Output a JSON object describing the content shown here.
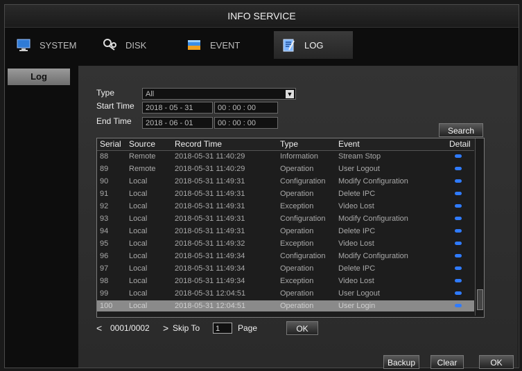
{
  "window": {
    "title": "INFO SERVICE"
  },
  "tabs": [
    {
      "label": "SYSTEM",
      "icon": "monitor-icon",
      "active": false
    },
    {
      "label": "DISK",
      "icon": "disk-icon",
      "active": false
    },
    {
      "label": "EVENT",
      "icon": "event-icon",
      "active": false
    },
    {
      "label": "LOG",
      "icon": "log-icon",
      "active": true
    }
  ],
  "sidebar": {
    "items": [
      {
        "label": "Log",
        "selected": true
      }
    ]
  },
  "filters": {
    "type_label": "Type",
    "type_value": "All",
    "start_label": "Start Time",
    "start_date": "2018 - 05 - 31",
    "start_time": "00 : 00 : 00",
    "end_label": "End Time",
    "end_date": "2018 - 06 - 01",
    "end_time": "00 : 00 : 00",
    "search_label": "Search"
  },
  "table": {
    "headers": [
      "Serial",
      "Source",
      "Record Time",
      "Type",
      "Event",
      "Detail"
    ],
    "rows": [
      {
        "serial": "88",
        "source": "Remote",
        "time": "2018-05-31 11:40:29",
        "type": "Information",
        "event": "Stream Stop"
      },
      {
        "serial": "89",
        "source": "Remote",
        "time": "2018-05-31 11:40:29",
        "type": "Operation",
        "event": "User Logout"
      },
      {
        "serial": "90",
        "source": "Local",
        "time": "2018-05-31 11:49:31",
        "type": "Configuration",
        "event": "Modify Configuration"
      },
      {
        "serial": "91",
        "source": "Local",
        "time": "2018-05-31 11:49:31",
        "type": "Operation",
        "event": "Delete IPC"
      },
      {
        "serial": "92",
        "source": "Local",
        "time": "2018-05-31 11:49:31",
        "type": "Exception",
        "event": "Video Lost"
      },
      {
        "serial": "93",
        "source": "Local",
        "time": "2018-05-31 11:49:31",
        "type": "Configuration",
        "event": "Modify Configuration"
      },
      {
        "serial": "94",
        "source": "Local",
        "time": "2018-05-31 11:49:31",
        "type": "Operation",
        "event": "Delete IPC"
      },
      {
        "serial": "95",
        "source": "Local",
        "time": "2018-05-31 11:49:32",
        "type": "Exception",
        "event": "Video Lost"
      },
      {
        "serial": "96",
        "source": "Local",
        "time": "2018-05-31 11:49:34",
        "type": "Configuration",
        "event": "Modify Configuration"
      },
      {
        "serial": "97",
        "source": "Local",
        "time": "2018-05-31 11:49:34",
        "type": "Operation",
        "event": "Delete IPC"
      },
      {
        "serial": "98",
        "source": "Local",
        "time": "2018-05-31 11:49:34",
        "type": "Exception",
        "event": "Video Lost"
      },
      {
        "serial": "99",
        "source": "Local",
        "time": "2018-05-31 12:04:51",
        "type": "Operation",
        "event": "User Logout"
      },
      {
        "serial": "100",
        "source": "Local",
        "time": "2018-05-31 12:04:51",
        "type": "Operation",
        "event": "User Login"
      }
    ],
    "selected_serial": "100"
  },
  "pager": {
    "prev": "<",
    "page_info": "0001/0002",
    "next": ">",
    "skip_label": "Skip To",
    "skip_value": "1",
    "page_label": "Page",
    "ok_label": "OK"
  },
  "footer": {
    "backup_label": "Backup",
    "clear_label": "Clear",
    "ok_label": "OK"
  },
  "colors": {
    "detail_dot": "#2f7bff",
    "selected_row": "#8a8a8a",
    "background": "#0d0d0d"
  }
}
